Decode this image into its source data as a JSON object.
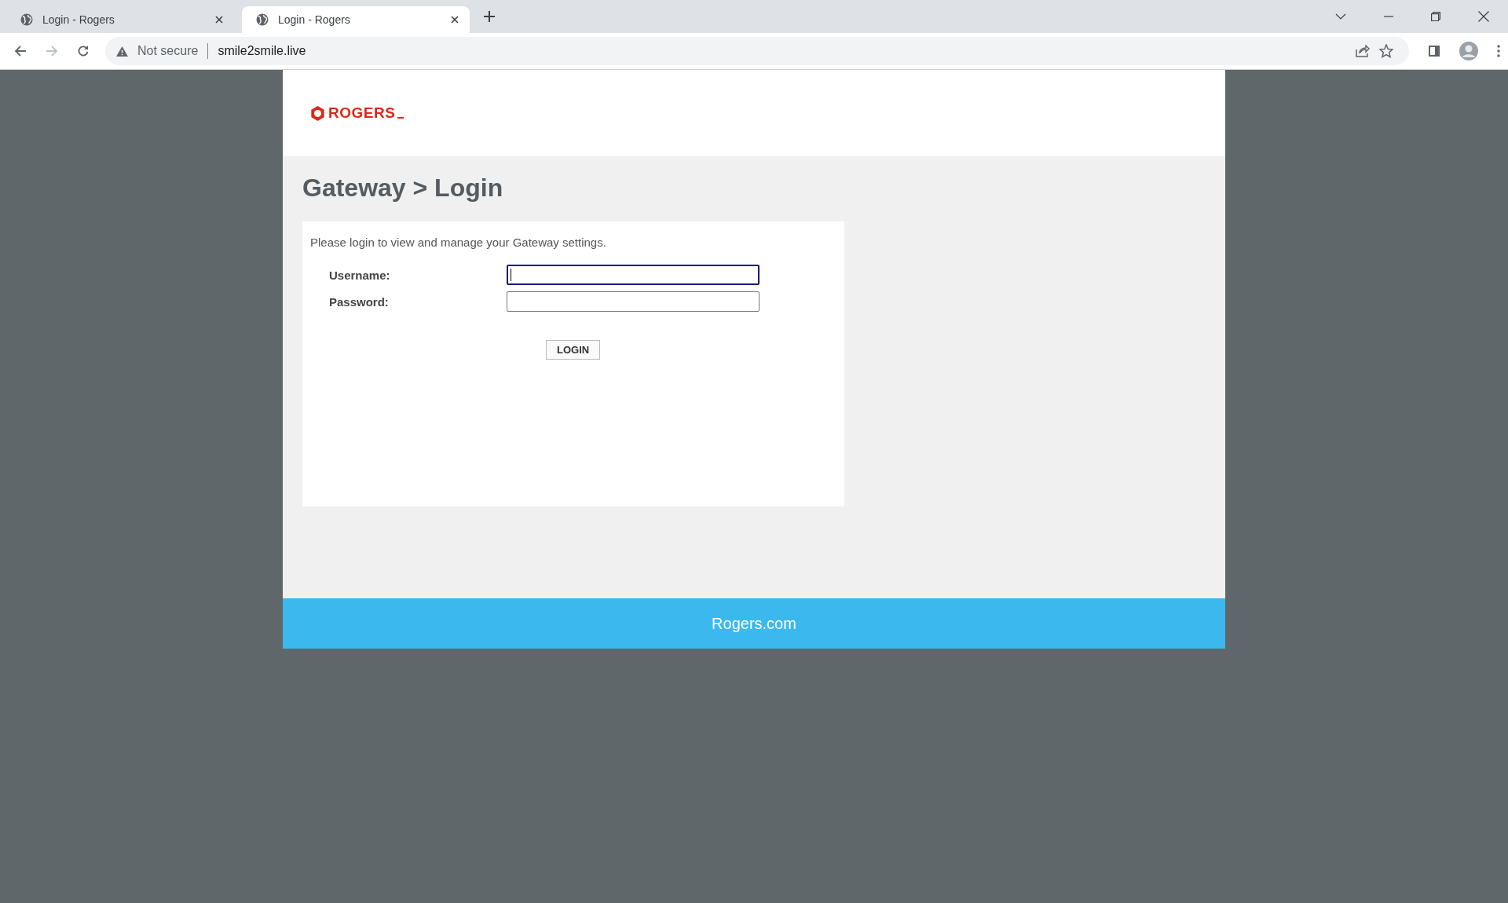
{
  "browser": {
    "tabs": [
      {
        "title": "Login - Rogers",
        "selected": false
      },
      {
        "title": "Login - Rogers",
        "selected": true
      }
    ],
    "address_bar": {
      "security": "Not secure",
      "url": "smile2smile.live"
    }
  },
  "header": {
    "logo_text": "ROGERS"
  },
  "page_title": "Gateway > Login",
  "login_card": {
    "intro": "Please login to view and manage your Gateway settings.",
    "fields": [
      {
        "label": "Username:",
        "focused": true
      },
      {
        "label": "Password:",
        "focused": false
      }
    ],
    "button": "LOGIN"
  },
  "footer": {
    "link": "Rogers.com"
  }
}
